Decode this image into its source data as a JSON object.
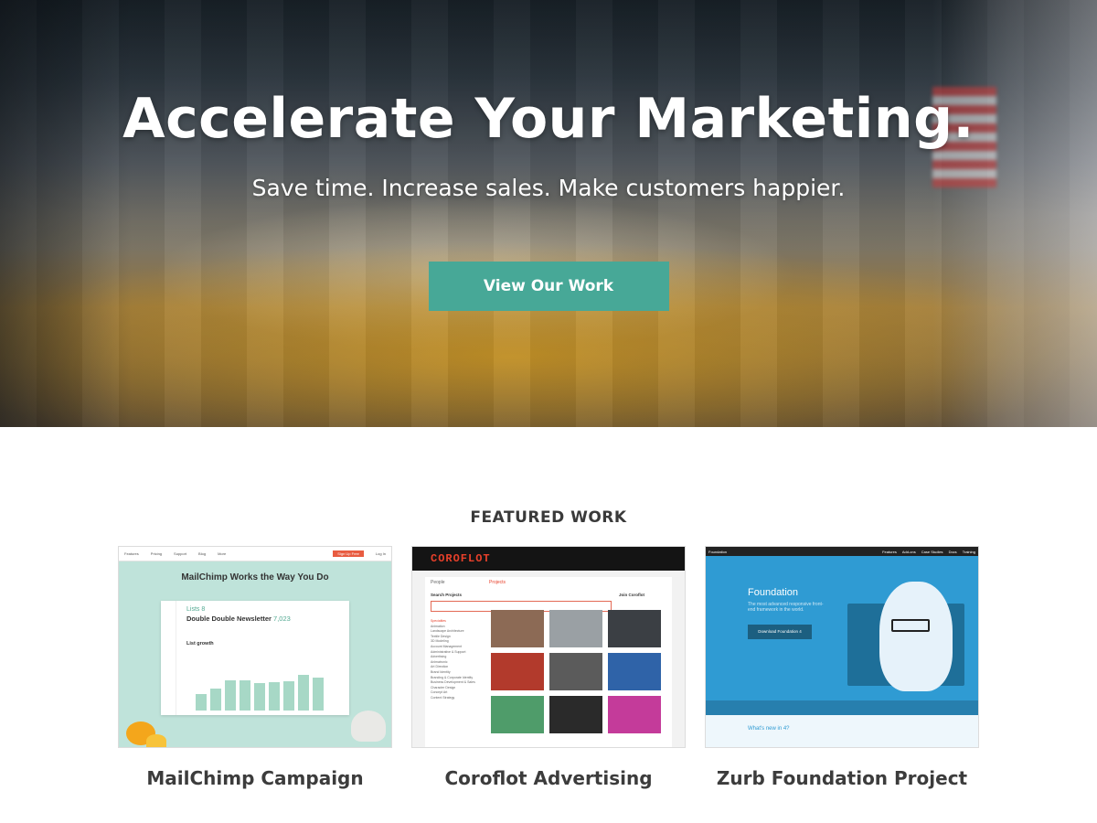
{
  "hero": {
    "title": "Accelerate Your Marketing.",
    "subtitle": "Save time. Increase sales. Make customers happier.",
    "cta_label": "View Our Work"
  },
  "featured": {
    "heading": "FEATURED WORK",
    "items": [
      {
        "title": "MailChimp Campaign",
        "screenshot": {
          "headline": "MailChimp Works the Way You Do",
          "lists_label": "Lists 8",
          "newsletter_name": "Double Double Newsletter",
          "subscriber_count": "7,023",
          "section_label": "List growth",
          "nav": [
            "Features",
            "Pricing",
            "Support",
            "Blog",
            "More"
          ],
          "signup_label": "Sign Up Free",
          "login_label": "Log In"
        }
      },
      {
        "title": "Coroflot Advertising",
        "screenshot": {
          "logo": "COROFLOT",
          "tabs": [
            "People",
            "Projects"
          ],
          "search_label": "Search Projects",
          "join_label": "Join Coroflot",
          "specialties": [
            "Specialties",
            "Animation",
            "Landscape Architecture",
            "Textile Design",
            "3D Modeling",
            "Account Management",
            "Administrative & Support",
            "Advertising",
            "Animatronic",
            "Art Direction",
            "Brand Identity",
            "Branding & Corporate Identity",
            "Business Development & Sales",
            "Character Design",
            "Concept Art",
            "Content Strategy"
          ]
        }
      },
      {
        "title": "Zurb Foundation Project",
        "screenshot": {
          "brand": "Foundation",
          "title": "Foundation",
          "subtitle": "The most advanced responsive front-end framework in the world.",
          "button_label": "Download Foundation 4",
          "whats_new": "What's new in 4?",
          "nav": [
            "Features",
            "Add-ons",
            "Case Studies",
            "Docs",
            "Training"
          ]
        }
      }
    ]
  },
  "colors": {
    "accent": "#47a897",
    "coroflot_red": "#e8402a",
    "foundation_blue": "#2f9bd3"
  }
}
